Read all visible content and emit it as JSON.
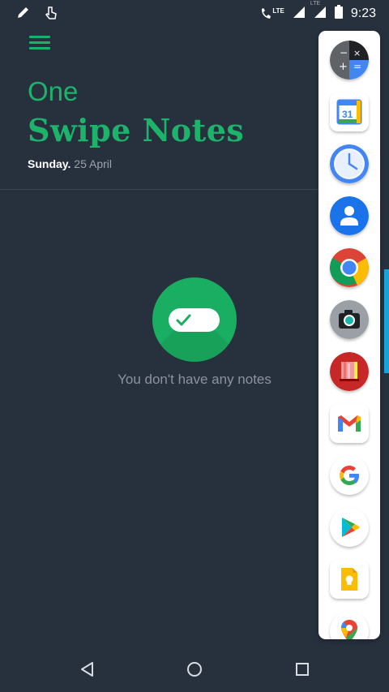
{
  "status_bar": {
    "time": "9:23",
    "icons": [
      "pencil-icon",
      "touch-icon",
      "lte-call-icon",
      "signal-icon",
      "signal-icon",
      "battery-icon"
    ],
    "network_label": "LTE",
    "secondary_network_label": "LTE"
  },
  "header": {
    "menu_icon": "hamburger-menu-icon",
    "title_line1": "One",
    "title_line2": "Swipe Notes",
    "day": "Sunday.",
    "date": " 25 April"
  },
  "main": {
    "empty_icon": "toggle-check-icon",
    "empty_message": "You don't have any notes"
  },
  "sidebar": {
    "apps": [
      "Calculator",
      "Calendar",
      "Clock",
      "Contacts",
      "Chrome",
      "Camera",
      "Books",
      "Gmail",
      "Google",
      "Play Store",
      "Keep",
      "Maps"
    ],
    "calendar_day": "31"
  },
  "nav": {
    "back_icon": "back-triangle-icon",
    "home_icon": "home-circle-icon",
    "recents_icon": "recents-square-icon"
  },
  "colors": {
    "background": "#27303d",
    "accent": "#1db36b",
    "scroll_indicator": "#1aa3d9"
  }
}
